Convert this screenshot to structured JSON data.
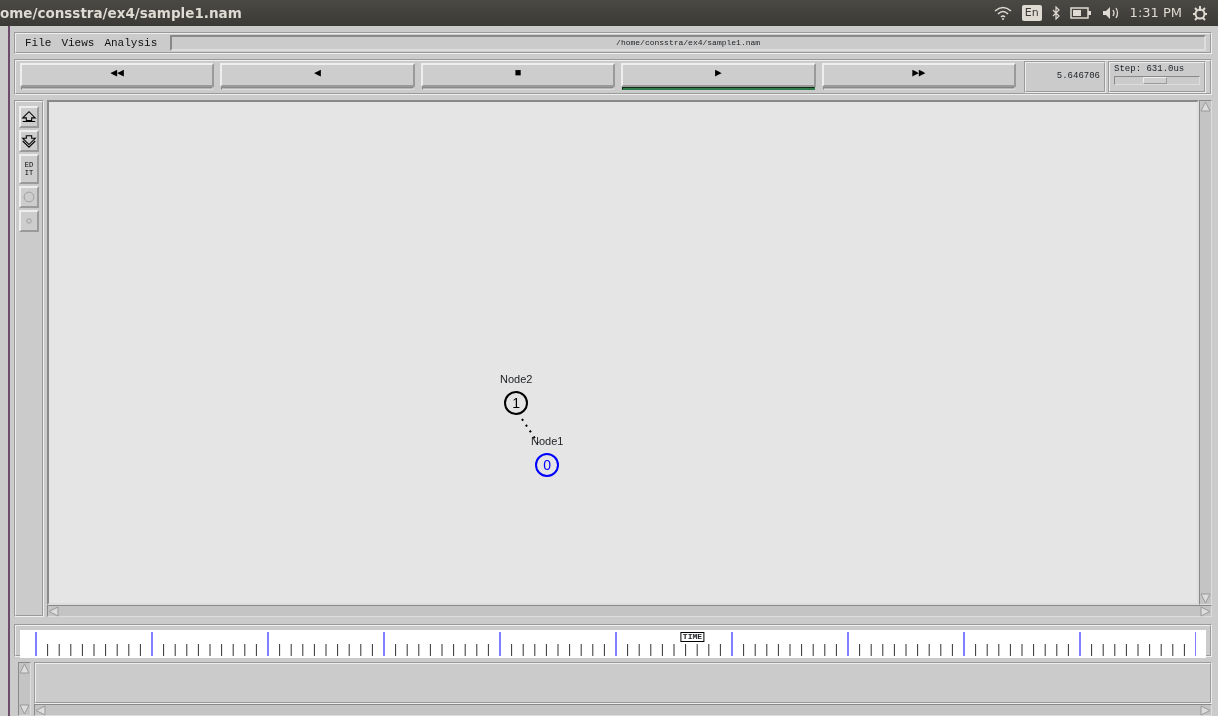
{
  "top_bar": {
    "title": "ome/consstra/ex4/sample1.nam",
    "keyboard": "En",
    "clock": "1:31 PM"
  },
  "menu": [
    {
      "label": "File"
    },
    {
      "label": "Views"
    },
    {
      "label": "Analysis"
    }
  ],
  "file_path": "/home/consstra/ex4/sample1.nam",
  "playback": [
    {
      "label": "◀◀",
      "selected": false
    },
    {
      "label": "◀",
      "selected": false
    },
    {
      "label": "■",
      "selected": false
    },
    {
      "label": "▶",
      "selected": true
    },
    {
      "label": "▶▶",
      "selected": false
    }
  ],
  "time": "5.646706",
  "step": {
    "label": "Step: 631.0us",
    "level": 0.48
  },
  "tools": [
    {
      "kind": "icon"
    },
    {
      "kind": "icon"
    },
    {
      "kind": "text",
      "label": "EDIT"
    },
    {
      "kind": "icon"
    },
    {
      "kind": "icon"
    }
  ],
  "nodes": [
    {
      "label": "Node2",
      "number": "1",
      "color": "#000000"
    },
    {
      "label": "Node1",
      "number": "0",
      "color": "#0000ff"
    }
  ],
  "timeline": {
    "label": "TIME",
    "level": 0.567
  }
}
